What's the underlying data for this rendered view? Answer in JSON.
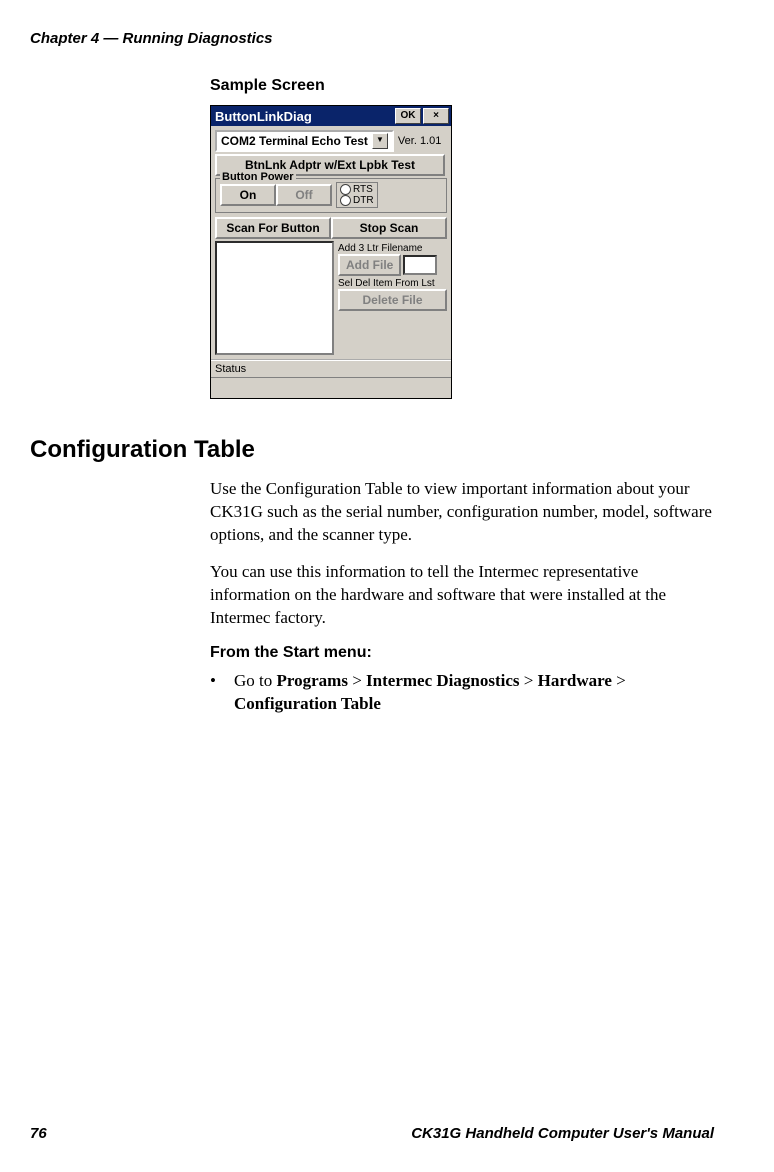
{
  "chapter_header": "Chapter 4 — Running Diagnostics",
  "sample_heading": "Sample Screen",
  "screenshot": {
    "title": "ButtonLinkDiag",
    "ok": "OK",
    "close": "×",
    "combo": "COM2 Terminal Echo Test",
    "version": "Ver. 1.01",
    "btn2": "BtnLnk Adptr w/Ext Lpbk Test",
    "group_label": "Button Power",
    "on": "On",
    "off": "Off",
    "rts": "RTS",
    "dtr": "DTR",
    "scan": "Scan For Button",
    "stop": "Stop Scan",
    "add_label": "Add 3 Ltr Filename",
    "add_file": "Add File",
    "del_label": "Sel Del Item From Lst",
    "del_file": "Delete File",
    "status": "Status"
  },
  "section_heading": "Configuration Table",
  "para1": "Use the Configuration Table to view important information about your CK31G such as the serial number, configuration number, model, software options, and the scanner type.",
  "para2": "You can use this information to tell the Intermec representative information on the hardware and software that were installed at the Intermec factory.",
  "subheading": "From the Start menu:",
  "bullet": {
    "prefix": "Go to ",
    "p1": "Programs",
    "sep": " > ",
    "p2": "Intermec Diagnostics",
    "p3": "Hardware",
    "p4": "Configuration Table"
  },
  "footer": {
    "page": "76",
    "manual": "CK31G Handheld Computer User's Manual"
  }
}
